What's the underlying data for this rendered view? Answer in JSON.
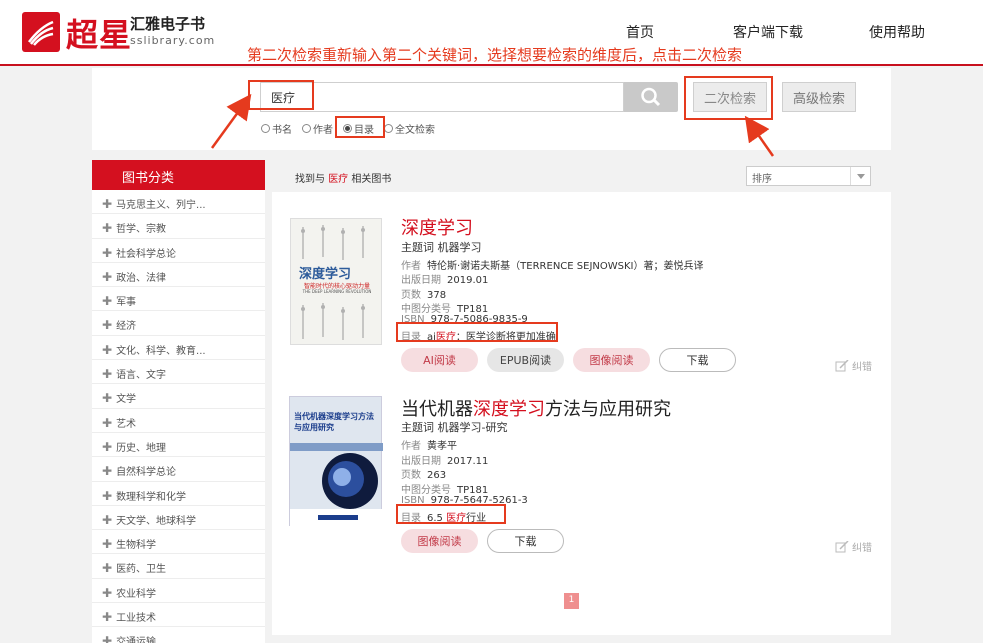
{
  "header": {
    "logo_chars": "超星",
    "brand_name": "汇雅电子书",
    "brand_site": "sslibrary.com",
    "nav": [
      "首页",
      "客户端下载",
      "使用帮助"
    ]
  },
  "annotation": {
    "text": "第二次检索重新输入第二个关键词，选择想要检索的维度后，点击二次检索",
    "color": "#e53a1e"
  },
  "search": {
    "value": "医疗",
    "options": [
      {
        "label": "书名",
        "selected": false
      },
      {
        "label": "作者",
        "selected": false
      },
      {
        "label": "目录",
        "selected": true
      },
      {
        "label": "全文检索",
        "selected": false
      }
    ],
    "secondary_search_label": "二次检索",
    "advanced_search_label": "高级检索"
  },
  "sidebar": {
    "title": "图书分类",
    "items": [
      "马克思主义、列宁...",
      "哲学、宗教",
      "社会科学总论",
      "政治、法律",
      "军事",
      "经济",
      "文化、科学、教育...",
      "语言、文字",
      "文学",
      "艺术",
      "历史、地理",
      "自然科学总论",
      "数理科学和化学",
      "天文学、地球科学",
      "生物科学",
      "医药、卫生",
      "农业科学",
      "工业技术",
      "交通运输"
    ]
  },
  "results": {
    "found_prefix": "找到与",
    "keyword": "医疗",
    "found_suffix": "相关图书",
    "sort_label": "排序",
    "books": [
      {
        "title": "深度学习",
        "subject_label": "主题词",
        "subject": "机器学习",
        "author_label": "作者",
        "author": "特伦斯·谢诺夫斯基（TERRENCE SEJNOWSKI）著；姜悦兵译",
        "date_label": "出版日期",
        "date": "2019.01",
        "pages_label": "页数",
        "pages": "378",
        "clc_label": "中图分类号",
        "clc": "TP181",
        "isbn_label": "ISBN",
        "isbn": "978-7-5086-9835-9",
        "toc_label": "目录",
        "toc_pre": "ai",
        "toc_kw": "医疗",
        "toc_post": "：医学诊断将更加准确",
        "cover_title": "深度学习",
        "cover_subtitle": "智能时代的核心驱动力量",
        "cover_en": "THE DEEP LEARNING REVOLUTION",
        "buttons": [
          "AI阅读",
          "EPUB阅读",
          "图像阅读",
          "下载"
        ]
      },
      {
        "title_pre": "当代机器",
        "title_hl": "深度学习",
        "title_post": "方法与应用研究",
        "subject_label": "主题词",
        "subject": "机器学习-研究",
        "author_label": "作者",
        "author": "黄孝平",
        "date_label": "出版日期",
        "date": "2017.11",
        "pages_label": "页数",
        "pages": "263",
        "clc_label": "中图分类号",
        "clc": "TP181",
        "isbn_label": "ISBN",
        "isbn": "978-7-5647-5261-3",
        "toc_label": "目录",
        "toc_pre": "6.5",
        "toc_kw": "医疗",
        "toc_post": "行业",
        "cover_title": "当代机器深度学习方法与应用研究",
        "buttons": [
          "图像阅读",
          "下载"
        ]
      }
    ],
    "correction_label": "纠错",
    "page": "1"
  }
}
